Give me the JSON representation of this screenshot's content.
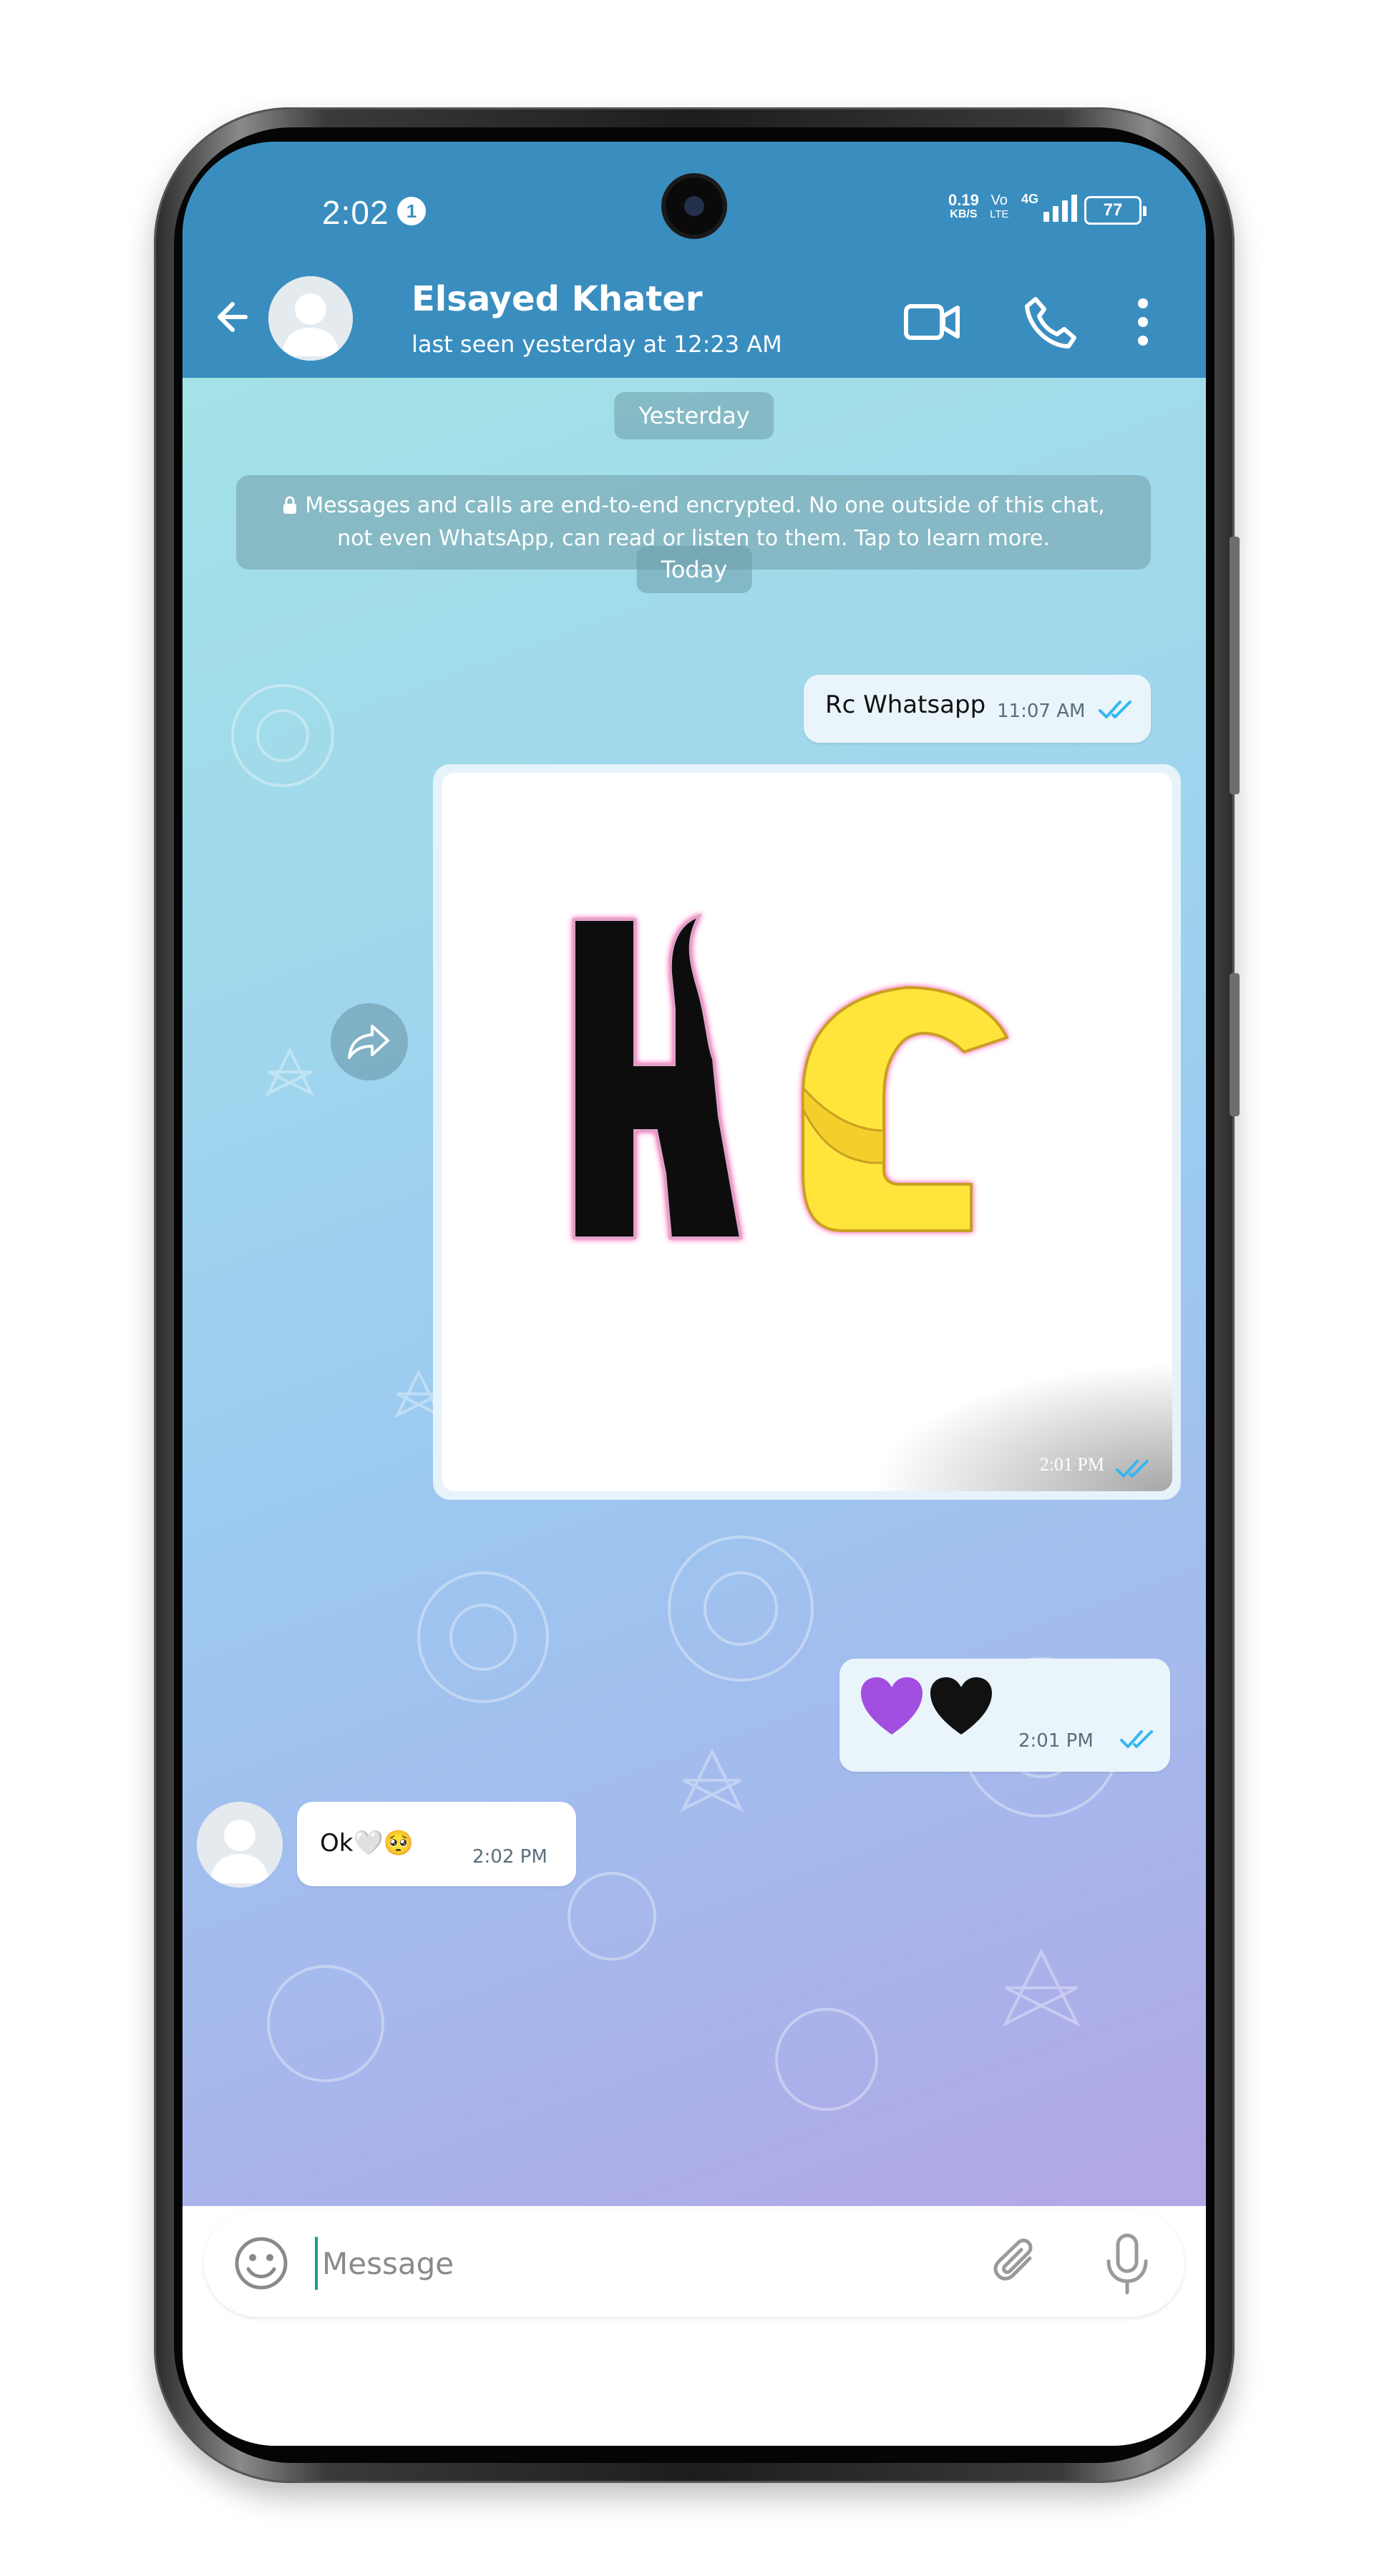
{
  "status_bar": {
    "time": "2:02",
    "notification_count": "1",
    "net_speed_value": "0.19",
    "net_speed_unit": "KB/S",
    "volte_top": "Vo",
    "volte_bottom": "LTE",
    "network_type": "4G",
    "battery": "77"
  },
  "header": {
    "contact_name": "Elsayed Khater",
    "last_seen": "last seen yesterday at 12:23 AM",
    "icons": [
      "back-arrow-icon",
      "avatar-icon",
      "video-call-icon",
      "phone-call-icon",
      "more-vert-icon"
    ]
  },
  "chat": {
    "date_yesterday": "Yesterday",
    "encryption_notice": "Messages and calls are end-to-end encrypted. No one outside of this chat, not even WhatsApp, can read or listen to them. Tap to learn more.",
    "date_today": "Today",
    "messages": [
      {
        "direction": "out",
        "text": "Rc Whatsapp",
        "time": "11:07 AM",
        "status": "read"
      },
      {
        "direction": "out",
        "type": "image",
        "image_text": "Rc",
        "time": "2:01 PM",
        "status": "read"
      },
      {
        "direction": "out",
        "text": "💜🖤",
        "time": "2:01 PM",
        "status": "read"
      },
      {
        "direction": "in",
        "text": "Ok🤍🥺",
        "time": "2:02 PM"
      }
    ]
  },
  "composer": {
    "placeholder": "Message",
    "value": ""
  },
  "colors": {
    "header_blue": "#3a8ebf",
    "outgoing_bubble": "#eaf4fb",
    "incoming_bubble": "#ffffff",
    "read_tick": "#34b7f1",
    "logo_black": "#111111",
    "logo_yellow": "#ffe53b"
  }
}
